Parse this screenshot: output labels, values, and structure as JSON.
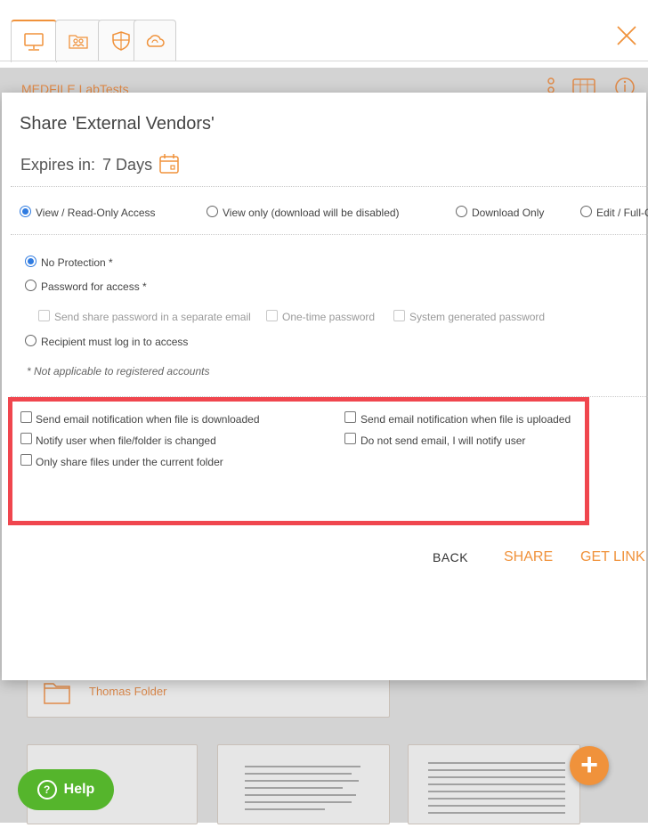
{
  "background": {
    "title": "MEDFILE LabTests",
    "folder_name": "Thomas Folder"
  },
  "tabs": [
    {
      "icon": "computer-icon",
      "active": true
    },
    {
      "icon": "shared-users-icon",
      "active": false
    },
    {
      "icon": "shield-icon",
      "active": false
    },
    {
      "icon": "cloud-sync-icon",
      "active": false
    }
  ],
  "modal": {
    "title": "Share 'External Vendors'",
    "expires_label": "Expires in:",
    "expires_value": "7 Days",
    "access_options": [
      {
        "label": "View / Read-Only Access",
        "selected": true
      },
      {
        "label": "View only (download will be disabled)",
        "selected": false
      },
      {
        "label": "Download Only",
        "selected": false
      },
      {
        "label": "Edit / Full-C",
        "selected": false
      }
    ],
    "protection_options": [
      {
        "label": "No Protection *",
        "selected": true
      },
      {
        "label": "Password for access *",
        "selected": false
      },
      {
        "label": "Recipient must log in to access",
        "selected": false
      }
    ],
    "password_sub_options": [
      {
        "label": "Send share password in a separate email"
      },
      {
        "label": "One-time password"
      },
      {
        "label": "System generated password"
      }
    ],
    "note": "* Not applicable to registered accounts",
    "notify_options": [
      {
        "label": "Send email notification when file is downloaded",
        "checked": false
      },
      {
        "label": "Send email notification when file is uploaded",
        "checked": false
      },
      {
        "label": "Notify user when file/folder is changed",
        "checked": false
      },
      {
        "label": "Do not send email, I will notify user",
        "checked": false
      },
      {
        "label": "Only share files under the current folder",
        "checked": false
      }
    ],
    "buttons": {
      "back": "BACK",
      "share": "SHARE",
      "get_link": "GET LINK"
    }
  },
  "help_label": "Help",
  "fab_label": "+",
  "colors": {
    "accent": "#f0923b",
    "radio_selected": "#2f7be0",
    "highlight": "#f0464e",
    "help": "#55b52c"
  }
}
